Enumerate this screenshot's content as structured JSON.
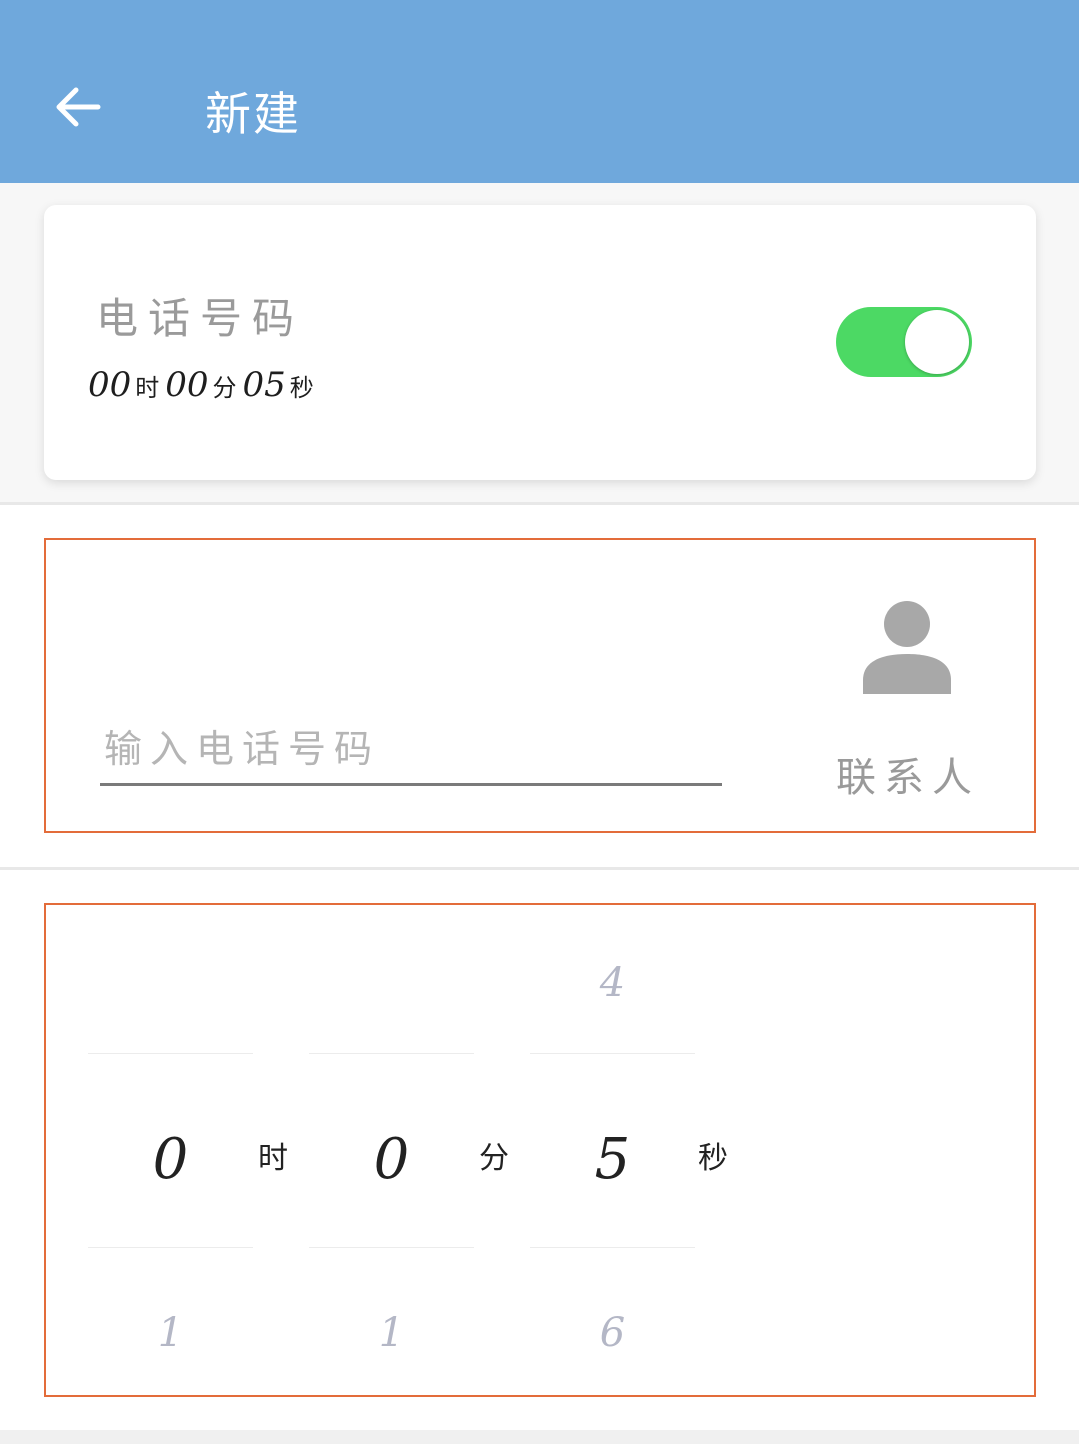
{
  "appbar": {
    "title": "新建",
    "back_icon": "arrow-left-icon"
  },
  "task_card": {
    "title": "电话号码",
    "time": {
      "hours": "00",
      "hours_unit": "时",
      "minutes": "00",
      "minutes_unit": "分",
      "seconds": "05",
      "seconds_unit": "秒"
    },
    "toggle_on": true
  },
  "phone_section": {
    "input_placeholder": "输入电话号码",
    "input_value": "",
    "contact_icon": "person-icon",
    "contact_label": "联系人"
  },
  "picker": {
    "hours": {
      "above": "",
      "selected": "0",
      "below": "1",
      "unit": "时"
    },
    "minutes": {
      "above": "",
      "selected": "0",
      "below": "1",
      "unit": "分"
    },
    "seconds": {
      "above": "4",
      "selected": "5",
      "below": "6",
      "unit": "秒"
    }
  },
  "colors": {
    "appbar": "#6fa8dc",
    "toggle": "#4cd964",
    "highlight_border": "#e36c3a"
  }
}
